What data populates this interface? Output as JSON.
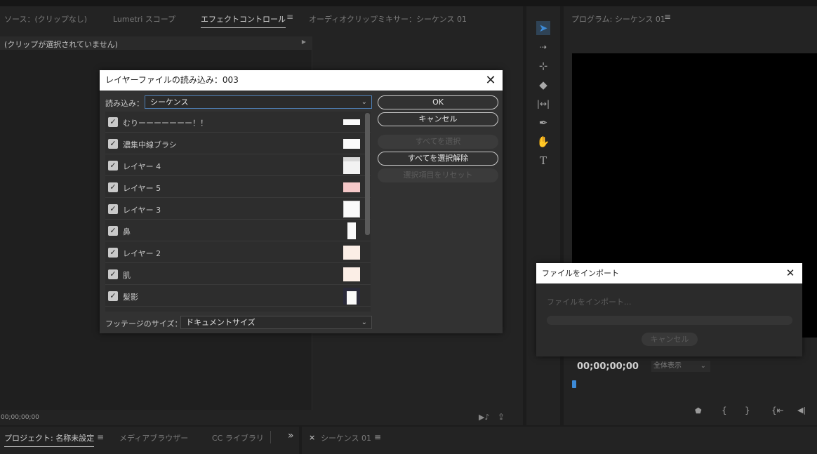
{
  "source_panel": {
    "tabs": [
      {
        "label": "ソース：(クリップなし)"
      },
      {
        "label": "Lumetri スコープ"
      },
      {
        "label": "エフェクトコントロール"
      },
      {
        "label": "オーディオクリップミキサー：シーケンス 01"
      }
    ],
    "no_clip_text": "(クリップが選択されていません)",
    "timecode": "00;00;00;00"
  },
  "program_panel": {
    "title": "プログラム: シーケンス 01",
    "timecode": "00;00;00;00",
    "zoom": "全体表示"
  },
  "project_panel": {
    "tabs": [
      {
        "label": "プロジェクト: 名称未設定"
      },
      {
        "label": "メディアブラウザー"
      },
      {
        "label": "CC ライブラリ"
      }
    ],
    "more": "»"
  },
  "timeline_panel": {
    "close": "×",
    "tab": "シーケンス 01"
  },
  "layer_dialog": {
    "title": "レイヤーファイルの読み込み：003",
    "import_label": "読み込み：",
    "import_value": "シーケンス",
    "layers": [
      {
        "name": "むりーーーーーーー！！"
      },
      {
        "name": "濃集中線ブラシ"
      },
      {
        "name": "レイヤー 4"
      },
      {
        "name": "レイヤー 5"
      },
      {
        "name": "レイヤー 3"
      },
      {
        "name": "鼻"
      },
      {
        "name": "レイヤー 2"
      },
      {
        "name": "肌"
      },
      {
        "name": "髪影"
      }
    ],
    "footage_label": "フッテージのサイズ：",
    "footage_value": "ドキュメントサイズ",
    "buttons": {
      "ok": "OK",
      "cancel": "キャンセル",
      "select_all": "すべてを選択",
      "deselect_all": "すべてを選択解除",
      "reset": "選択項目をリセット"
    }
  },
  "import_dialog": {
    "title": "ファイルをインポート",
    "status": "ファイルをインポート...",
    "progress": 0,
    "cancel": "キャンセル"
  }
}
